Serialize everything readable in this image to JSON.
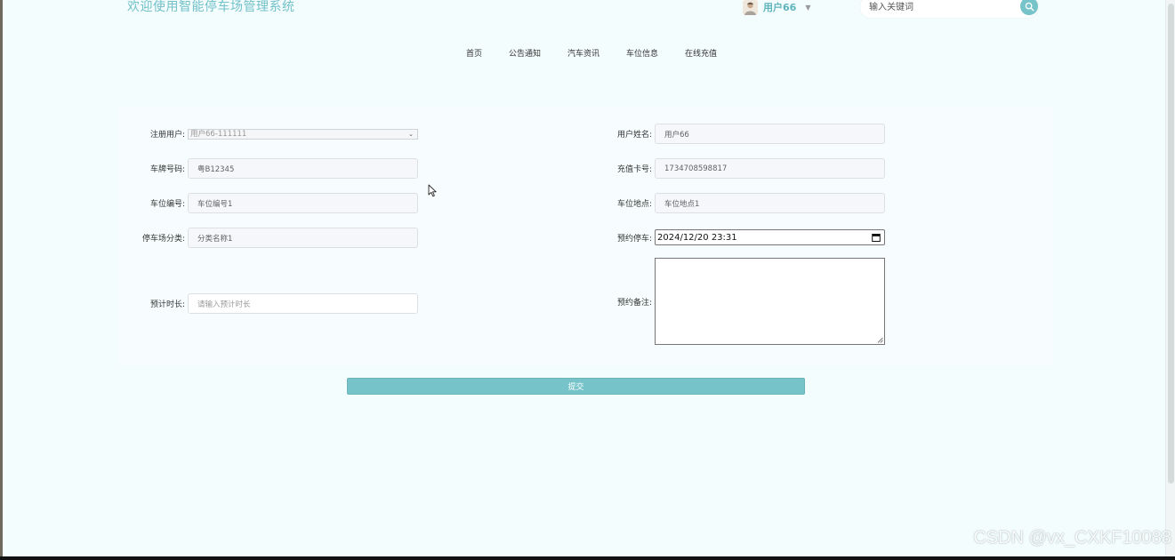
{
  "header": {
    "site_title": "欢迎使用智能停车场管理系统",
    "user_name": "用户66",
    "search_placeholder": "输入关键词"
  },
  "nav": {
    "items": [
      "首页",
      "公告通知",
      "汽车资讯",
      "车位信息",
      "在线充值"
    ]
  },
  "form": {
    "registered_user": {
      "label": "注册用户:",
      "value": "用户66-111111"
    },
    "user_name": {
      "label": "用户姓名:",
      "value": "用户66"
    },
    "plate_number": {
      "label": "车牌号码:",
      "value": "粤B12345"
    },
    "recharge_card": {
      "label": "充值卡号:",
      "value": "1734708598817"
    },
    "space_number": {
      "label": "车位编号:",
      "value": "车位编号1"
    },
    "space_location": {
      "label": "车位地点:",
      "value": "车位地点1"
    },
    "lot_category": {
      "label": "停车场分类:",
      "value": "分类名称1"
    },
    "reserve_time": {
      "label": "预约停车:",
      "value": "2024/12/20 23:31"
    },
    "estimated_duration": {
      "label": "预计时长:",
      "placeholder": "请输入预计时长"
    },
    "reserve_note": {
      "label": "预约备注:"
    },
    "submit_label": "提交"
  },
  "watermark": "CSDN @vx_CXKF10088",
  "colors": {
    "accent": "#76c3c9",
    "background": "#f4fdfe",
    "title": "#72c0c8"
  }
}
